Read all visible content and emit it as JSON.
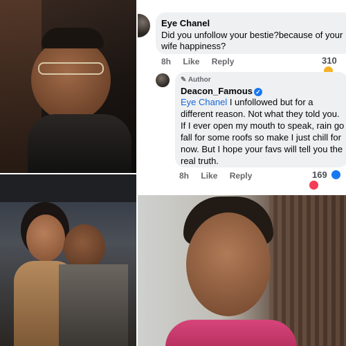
{
  "comment1": {
    "author": "Eye Chanel",
    "text_line1": "Did you unfollow your bestie?because of your",
    "text_line2": "wife happiness?",
    "time": "8h",
    "like_label": "Like",
    "reply_label": "Reply",
    "reaction_count": "310"
  },
  "comment2": {
    "author_badge": "Author",
    "author": "Deacon_Famous",
    "mention": "Eye Chanel",
    "text_after_mention": " I unfollowed but for a",
    "line2": "different reason. Not what they told you.",
    "line3": "If I ever open my mouth to speak, rain go",
    "line4": "fall for some roofs so make I just chill for",
    "line5": "now. But I hope your favs will tell you the",
    "line6": "real truth.",
    "time": "8h",
    "like_label": "Like",
    "reply_label": "Reply",
    "reaction_count": "169"
  },
  "colors": {
    "mention": "#1a66d4",
    "bubble": "#eef0f2",
    "verified": "#1877f2"
  }
}
